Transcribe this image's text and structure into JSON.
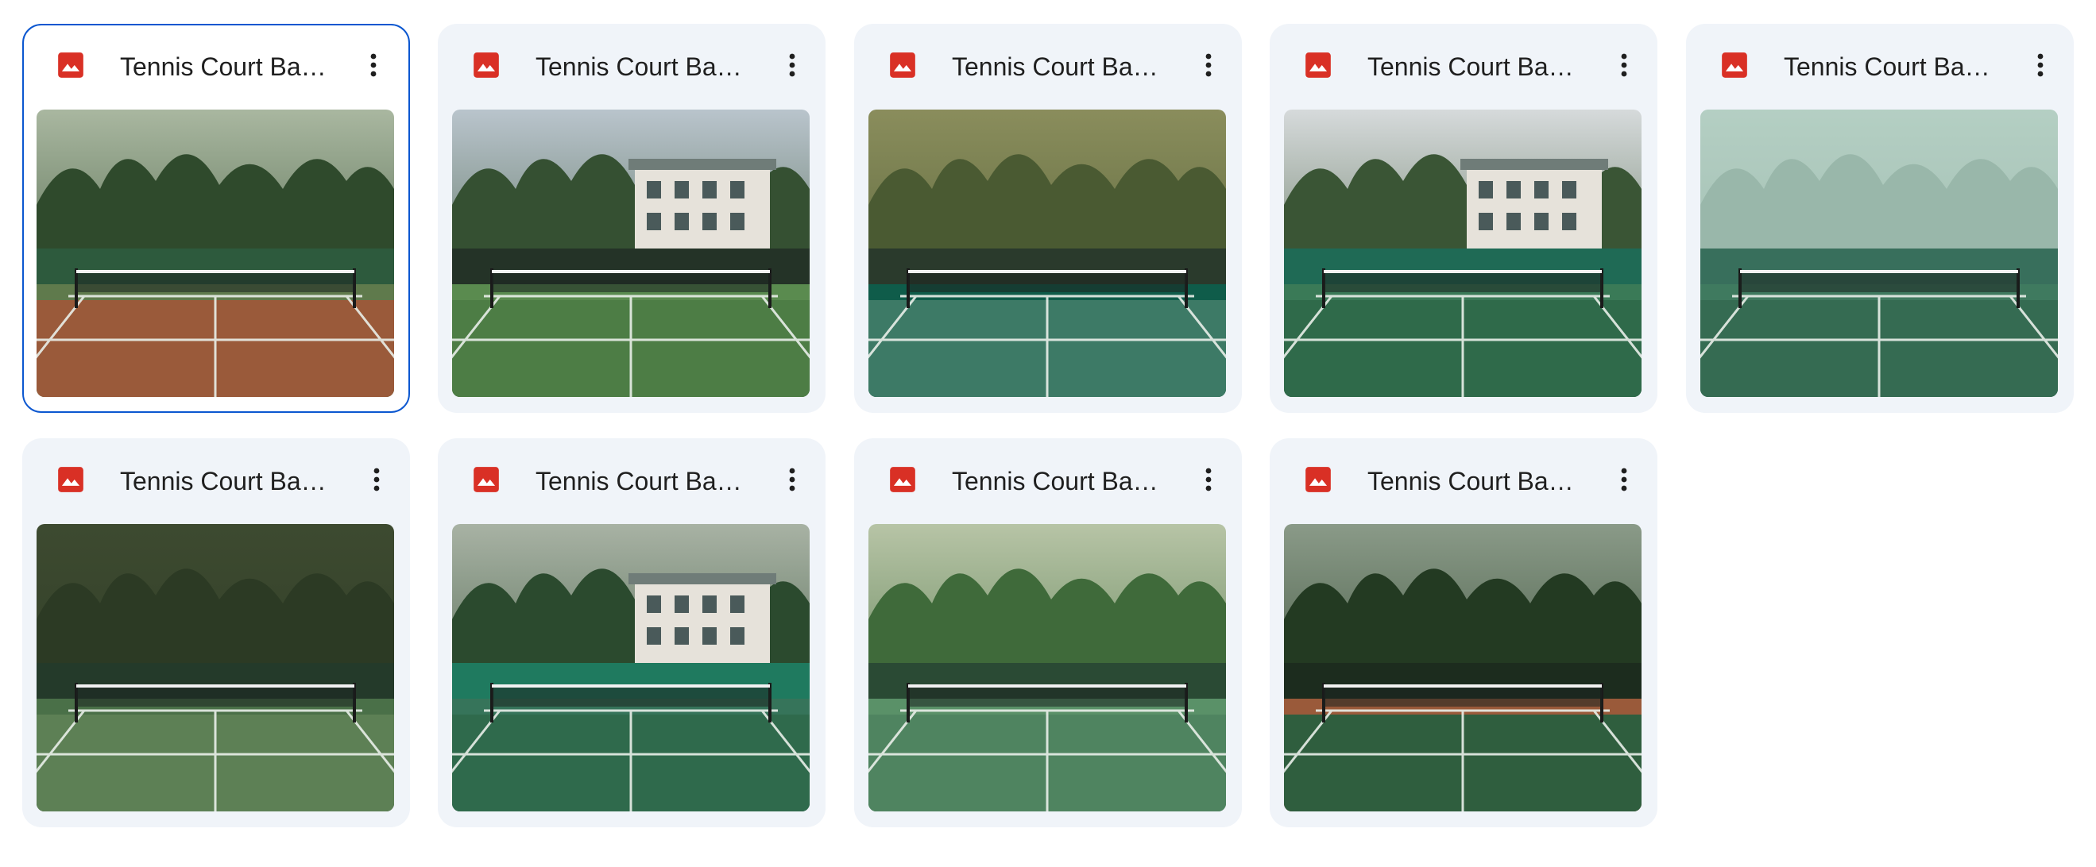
{
  "files": [
    {
      "title": "Tennis Court Bac...",
      "type_icon": "image-file-icon",
      "icon_color": "#d93025",
      "menu_icon": "more-vert-icon",
      "selected": true,
      "scene": {
        "sky": "#a9b7a0",
        "trees": "#2f4a2c",
        "wall": "#2d5a3d",
        "court": "#9a5a3a",
        "court2": "#5f7a4c",
        "building": false,
        "fog": false
      }
    },
    {
      "title": "Tennis Court Bac...",
      "type_icon": "image-file-icon",
      "icon_color": "#d93025",
      "menu_icon": "more-vert-icon",
      "selected": false,
      "scene": {
        "sky": "#b9c4cc",
        "trees": "#355032",
        "wall": "#243327",
        "court": "#4d7d45",
        "court2": "#5a8b4f",
        "building": true,
        "fog": false
      }
    },
    {
      "title": "Tennis Court Bac...",
      "type_icon": "image-file-icon",
      "icon_color": "#d93025",
      "menu_icon": "more-vert-icon",
      "selected": false,
      "scene": {
        "sky": "#8a8d5c",
        "trees": "#4a5a32",
        "wall": "#2a3a2c",
        "court": "#3d7a66",
        "court2": "#0f5c4a",
        "building": false,
        "fog": false
      }
    },
    {
      "title": "Tennis Court Bac...",
      "type_icon": "image-file-icon",
      "icon_color": "#d93025",
      "menu_icon": "more-vert-icon",
      "selected": false,
      "scene": {
        "sky": "#d6dadb",
        "trees": "#3a5535",
        "wall": "#1f6a55",
        "court": "#2f6a4a",
        "court2": "#3a7a57",
        "building": true,
        "fog": false
      }
    },
    {
      "title": "Tennis Court Bac...",
      "type_icon": "image-file-icon",
      "icon_color": "#d93025",
      "menu_icon": "more-vert-icon",
      "selected": false,
      "scene": {
        "sky": "#9fc1b3",
        "trees": "#6d9585",
        "wall": "#386f5c",
        "court": "#356b52",
        "court2": "#3f7a5f",
        "building": false,
        "fog": true
      }
    },
    {
      "title": "Tennis Court Bac...",
      "type_icon": "image-file-icon",
      "icon_color": "#d93025",
      "menu_icon": "more-vert-icon",
      "selected": false,
      "scene": {
        "sky": "#3d4a30",
        "trees": "#2c3a24",
        "wall": "#243a2a",
        "court": "#5d8055",
        "court2": "#4a7048",
        "building": false,
        "fog": false
      }
    },
    {
      "title": "Tennis Court Bac...",
      "type_icon": "image-file-icon",
      "icon_color": "#d93025",
      "menu_icon": "more-vert-icon",
      "selected": false,
      "scene": {
        "sky": "#a8b2a4",
        "trees": "#2b4a2e",
        "wall": "#1f7a5f",
        "court": "#2f6a4c",
        "court2": "#36745a",
        "building": true,
        "fog": false
      }
    },
    {
      "title": "Tennis Court Bac...",
      "type_icon": "image-file-icon",
      "icon_color": "#d93025",
      "menu_icon": "more-vert-icon",
      "selected": false,
      "scene": {
        "sky": "#b7c4a6",
        "trees": "#3f6a3a",
        "wall": "#2a4a34",
        "court": "#4f8460",
        "court2": "#5a9168",
        "building": false,
        "fog": false
      }
    },
    {
      "title": "Tennis Court Bac...",
      "type_icon": "image-file-icon",
      "icon_color": "#d93025",
      "menu_icon": "more-vert-icon",
      "selected": false,
      "scene": {
        "sky": "#8a9a88",
        "trees": "#233a22",
        "wall": "#1c2c1e",
        "court": "#2f5e3e",
        "court2": "#9a5a3a",
        "building": false,
        "fog": false
      }
    }
  ]
}
